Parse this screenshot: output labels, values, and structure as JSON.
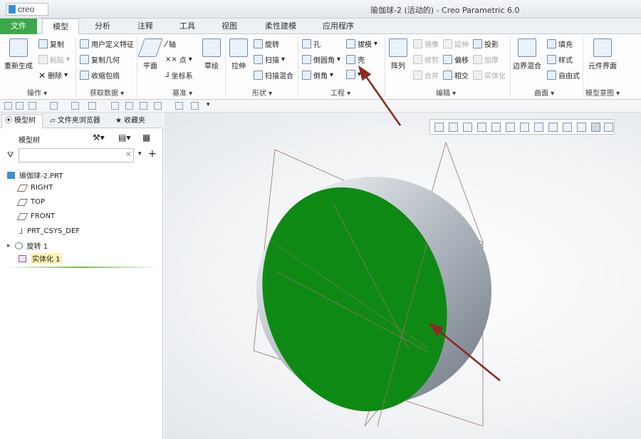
{
  "app": {
    "logo": "creo",
    "window_title": "瑜伽球-2 (活动的) - Creo Parametric 6.0"
  },
  "tabs": [
    "文件",
    "模型",
    "分析",
    "注释",
    "工具",
    "视图",
    "柔性建模",
    "应用程序"
  ],
  "ribbon": {
    "operations": {
      "regen": "重新生成",
      "copy": "复制",
      "paste": "粘贴",
      "delete": "删除",
      "label": "操作"
    },
    "get_data": {
      "udf": "用户定义特征",
      "copy_geom": "复制几何",
      "shrinkwrap": "收缩包络",
      "label": "获取数据"
    },
    "datum": {
      "plane": "平面",
      "axis": "轴",
      "point": "点",
      "csys": "坐标系",
      "sketch": "草绘",
      "label": "基准"
    },
    "shapes": {
      "extrude": "拉伸",
      "revolve": "旋转",
      "sweep": "扫描",
      "swept_blend": "扫描混合",
      "label": "形状"
    },
    "engineering": {
      "hole": "孔",
      "round": "倒圆角",
      "chamfer": "倒角",
      "draft": "拔模",
      "shell": "壳",
      "label": "工程"
    },
    "editing": {
      "pattern": "阵列",
      "mirror": "镜像",
      "trim": "修剪",
      "merge": "合并",
      "extend": "延伸",
      "offset": "偏移",
      "intersect": "相交",
      "project": "投影",
      "thicken": "加厚",
      "solidify": "实体化",
      "label": "编辑"
    },
    "surfaces": {
      "boundary_blend": "边界混合",
      "fill": "填充",
      "style": "样式",
      "freestyle": "自由式",
      "label": "曲面"
    },
    "model_intent": {
      "component_interface": "元件界面",
      "label": "模型意图"
    }
  },
  "panel": {
    "tabs": [
      "模型树",
      "文件夹浏览器",
      "收藏夹"
    ],
    "header": "模型树",
    "filter_placeholder": "",
    "tree": {
      "root": "瑜伽球-2.PRT",
      "items": [
        "RIGHT",
        "TOP",
        "FRONT",
        "PRT_CSYS_DEF",
        "旋转 1",
        "实体化 1"
      ]
    }
  },
  "colors": {
    "file_tab": "#3da84a",
    "surface_green": "#0e8a14",
    "sphere_gray": "#9aa3ad",
    "arrow": "#8c2a22",
    "datum_plane": "#9a7070",
    "highlight": "#fff3b0"
  }
}
